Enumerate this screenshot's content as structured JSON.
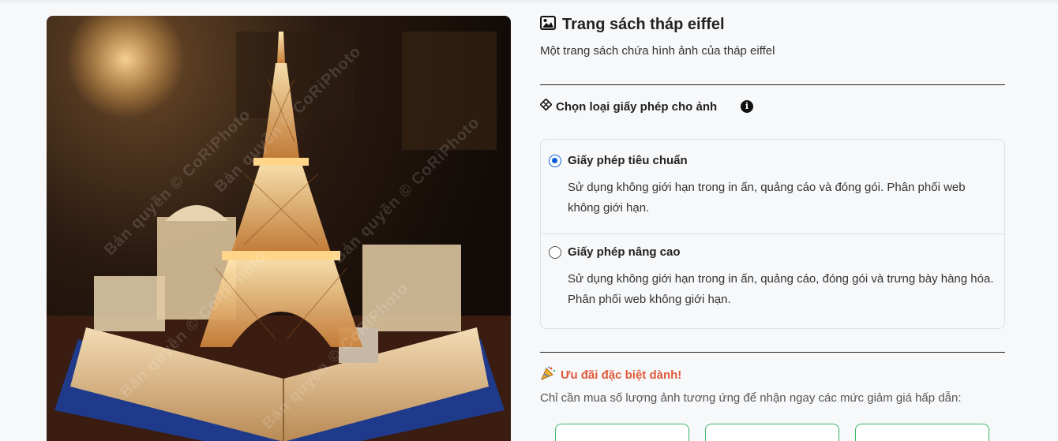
{
  "product": {
    "title": "Trang sách tháp eiffel",
    "description": "Một trang sách chứa hình ảnh của tháp eiffel",
    "image_alt": "Trang sách tháp eiffel",
    "watermark_text": "Bản quyền © CoRiPhoto"
  },
  "license": {
    "heading": "Chọn loại giấy phép cho ảnh",
    "info_icon": "info-circle-icon",
    "options": [
      {
        "name": "Giấy phép tiêu chuẩn",
        "description": "Sử dụng không giới hạn trong in ấn, quảng cáo và đóng gói. Phân phối web không giới hạn.",
        "selected": true
      },
      {
        "name": "Giấy phép nâng cao",
        "description": "Sử dụng không giới hạn trong in ấn, quảng cáo, đóng gói và trưng bày hàng hóa. Phân phối web không giới hạn.",
        "selected": false
      }
    ]
  },
  "promo": {
    "heading": "Ưu đãi đặc biệt dành!",
    "text": "Chỉ cần mua số lượng ảnh tương ứng để nhận ngay các mức giảm giá hấp dẫn:"
  },
  "colors": {
    "accent": "#0b5ed7",
    "promo": "#e05a3a",
    "card_border": "#3bb66a"
  }
}
